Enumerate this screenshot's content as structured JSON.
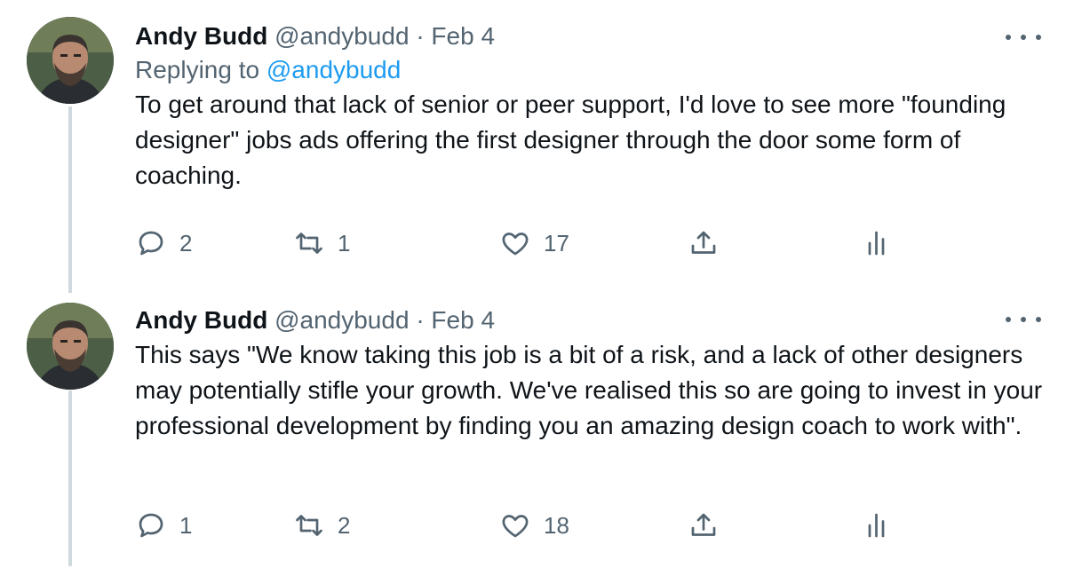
{
  "tweets": [
    {
      "author": {
        "name": "Andy Budd",
        "handle": "@andybudd"
      },
      "separator": "·",
      "date": "Feb 4",
      "replying_prefix": "Replying to",
      "replying_handle": "@andybudd",
      "text": "To get around that lack of senior or peer support, I'd love to see more \"founding designer\" jobs ads offering the first designer through the door some form of coaching.",
      "actions": {
        "replies": "2",
        "retweets": "1",
        "likes": "17"
      }
    },
    {
      "author": {
        "name": "Andy Budd",
        "handle": "@andybudd"
      },
      "separator": "·",
      "date": "Feb 4",
      "text": "This says \"We know taking this job is a bit of a risk, and a lack of other designers may potentially stifle your growth. We've realised this so are going to invest in your professional development by finding you an amazing design coach to work with\".",
      "actions": {
        "replies": "1",
        "retweets": "2",
        "likes": "18"
      }
    }
  ],
  "icons": {
    "reply": "reply-icon",
    "retweet": "retweet-icon",
    "like": "heart-icon",
    "share": "share-icon",
    "analytics": "analytics-icon",
    "more": "more-icon"
  },
  "colors": {
    "text": "#0f1419",
    "secondary": "#536471",
    "link": "#1d9bf0",
    "thread_line": "#cfd9de"
  }
}
